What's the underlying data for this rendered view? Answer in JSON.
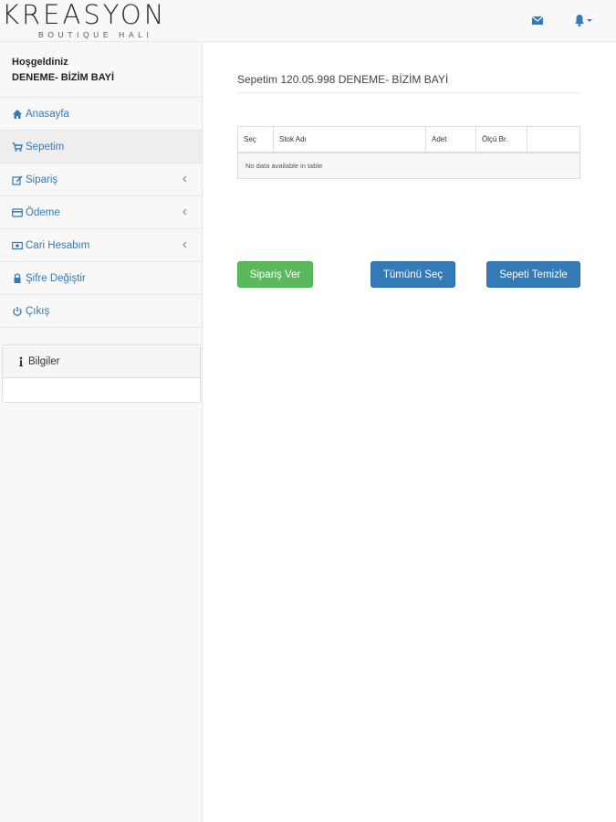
{
  "brand": {
    "name": "KREASYON",
    "tagline": "BOUTIQUE HALI"
  },
  "navbar": {
    "icons": [
      "envelope-icon",
      "bell-icon",
      "caret-down-icon"
    ]
  },
  "sidebar": {
    "welcome_title": "Hoşgeldiniz",
    "welcome_user": "DENEME- BİZİM BAYİ",
    "items": [
      {
        "label": "Anasayfa",
        "icon": "home-icon",
        "has_submenu": false
      },
      {
        "label": "Sepetim",
        "icon": "cart-icon",
        "has_submenu": false,
        "active": true
      },
      {
        "label": "Sipariş",
        "icon": "edit-icon",
        "has_submenu": true
      },
      {
        "label": "Ödeme",
        "icon": "credit-card-icon",
        "has_submenu": true
      },
      {
        "label": "Cari Hesabım",
        "icon": "money-icon",
        "has_submenu": true
      },
      {
        "label": "Şifre Değiştir",
        "icon": "lock-icon",
        "has_submenu": false
      },
      {
        "label": "Çıkış",
        "icon": "power-icon",
        "has_submenu": false
      }
    ],
    "info_panel": {
      "title": "Bilgiler",
      "icon": "info-icon"
    }
  },
  "main": {
    "heading": "Sepetim 120.05.998 DENEME- BİZİM BAYİ",
    "table": {
      "columns": [
        "Seç",
        "Stok Adı",
        "Adet",
        "Ölçü Br.",
        ""
      ],
      "empty_message": "No data available in table"
    },
    "buttons": {
      "order": "Sipariş Ver",
      "select_all": "Tümünü Seç",
      "clear_cart": "Sepeti Temizle"
    }
  },
  "colors": {
    "link": "#337ab7",
    "success": "#5cb85c",
    "primary": "#337ab7",
    "sidebar_bg": "#f8f8f8"
  }
}
